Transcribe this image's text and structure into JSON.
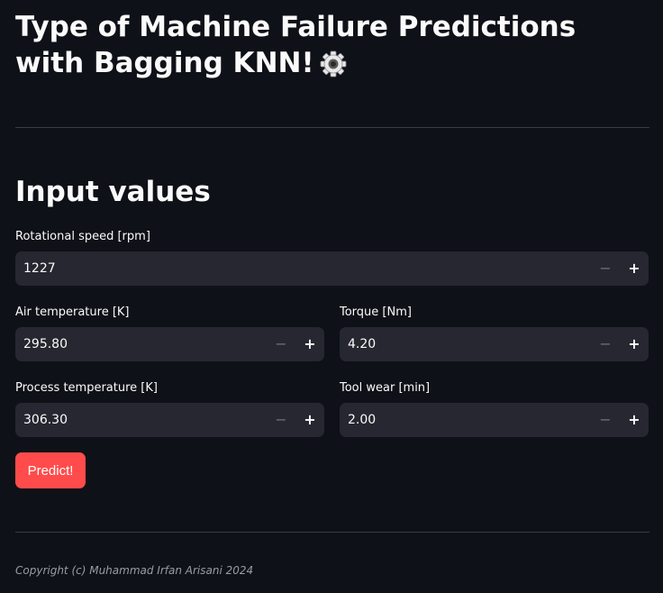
{
  "header": {
    "title": "Type of Machine Failure Predictions with Bagging KNN!",
    "title_icon": "gear-icon"
  },
  "inputs_section": {
    "heading": "Input values",
    "fields": {
      "rotational_speed": {
        "label": "Rotational speed [rpm]",
        "value": "1227"
      },
      "air_temperature": {
        "label": "Air temperature [K]",
        "value": "295.80"
      },
      "torque": {
        "label": "Torque [Nm]",
        "value": "4.20"
      },
      "process_temperature": {
        "label": "Process temperature [K]",
        "value": "306.30"
      },
      "tool_wear": {
        "label": "Tool wear [min]",
        "value": "2.00"
      }
    },
    "stepper": {
      "minus": "−",
      "plus": "+"
    },
    "predict_label": "Predict!"
  },
  "footer": {
    "copyright": "Copyright (c) Muhammad Irfan Arisani 2024"
  },
  "colors": {
    "background": "#0e1117",
    "input_background": "#262730",
    "primary_button": "#ff4b4b",
    "text": "#fafafa"
  }
}
